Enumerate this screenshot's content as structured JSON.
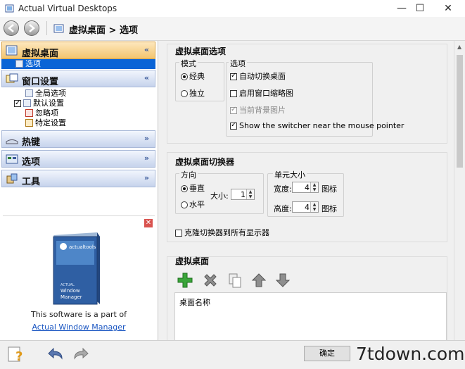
{
  "window": {
    "title": "Actual Virtual Desktops",
    "minimize": "—",
    "maximize": "☐",
    "close": "✕"
  },
  "nav": {
    "breadcrumb": "虚拟桌面 > 选项"
  },
  "sidebar": {
    "sections": [
      {
        "label": "虚拟桌面",
        "chevron": "«",
        "items": [
          {
            "label": "选项"
          }
        ]
      },
      {
        "label": "窗口设置",
        "chevron": "«",
        "items": [
          {
            "label": "全局选项"
          },
          {
            "label": "默认设置"
          },
          {
            "label": "忽略项"
          },
          {
            "label": "特定设置"
          }
        ]
      },
      {
        "label": "热键",
        "chevron": "»"
      },
      {
        "label": "选项",
        "chevron": "»"
      },
      {
        "label": "工具",
        "chevron": "»"
      }
    ]
  },
  "ad": {
    "close": "✕",
    "brand": "actualtools",
    "product_small": "ACTUAL",
    "product_line1": "Window",
    "product_line2": "Manager",
    "text": "This software is a part of",
    "link": "Actual Window Manager"
  },
  "main": {
    "group1": {
      "title": "虚拟桌面选项",
      "mode": {
        "legend": "模式",
        "classic": "经典",
        "independent": "独立"
      },
      "options": {
        "legend": "选项",
        "auto_switch": "自动切换桌面",
        "thumbnails": "启用窗口缩略图",
        "current_bg": "当前背景图片",
        "show_switcher": "Show the switcher near the mouse pointer"
      }
    },
    "group2": {
      "title": "虚拟桌面切换器",
      "direction": {
        "legend": "方向",
        "vertical": "垂直",
        "horizontal": "水平",
        "size_label": "大小:",
        "size_value": "1"
      },
      "cell": {
        "legend": "单元大小",
        "width_label": "宽度:",
        "width_value": "4",
        "height_label": "高度:",
        "height_value": "4",
        "unit": "图标"
      },
      "clone": "克隆切换器到所有显示器"
    },
    "group3": {
      "title": "虚拟桌面",
      "column": "桌面名称"
    }
  },
  "bottom": {
    "ok": "确定"
  },
  "watermark": "7tdown.com"
}
